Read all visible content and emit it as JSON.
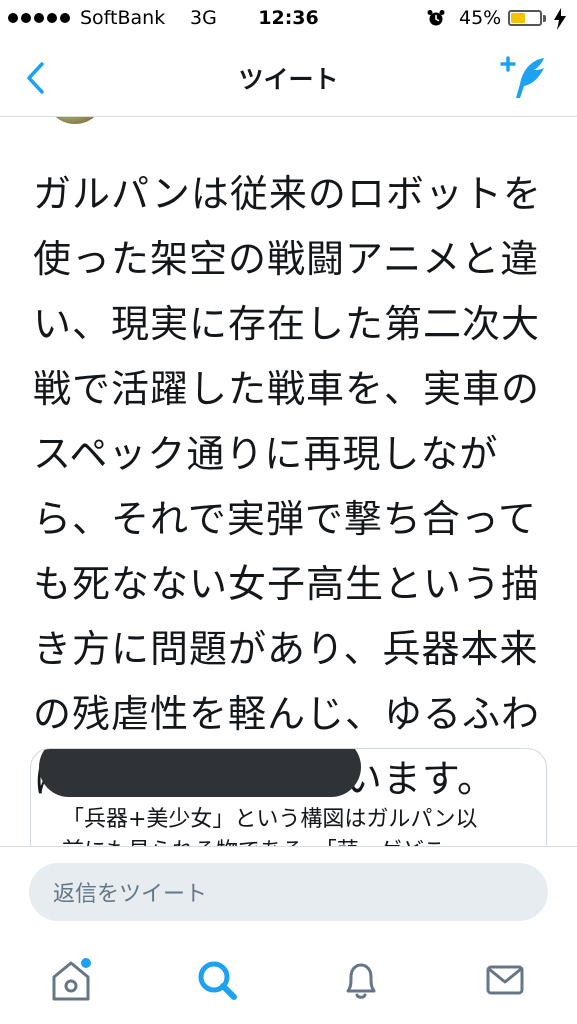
{
  "status_bar": {
    "carrier": "SoftBank",
    "network": "3G",
    "time": "12:36",
    "battery_percent": "45%",
    "battery_level": 0.45,
    "signal_bars": 5
  },
  "header": {
    "title": "ツイート",
    "back_icon": "chevron-left-icon",
    "compose_icon": "compose-tweet-icon",
    "accent_color": "#1da1f2"
  },
  "tweet": {
    "text": "ガルパンは従来のロボットを使った架空の戦闘アニメと違い、現実に存在した第二次大戦で活躍した戦車を、実車のスペック通りに再現しながら、それで実弾で撃ち合っても死なない女子高生という描き方に問題があり、兵器本来の残虐性を軽んじ、ゆるふわに描きぼやかしています。"
  },
  "quote": {
    "line1": "「兵器+美少女」という構図はガルパン以",
    "line2": "前にも見られる物である。「萌...ゲどこ"
  },
  "reply": {
    "placeholder": "返信をツイート"
  },
  "tabs": [
    {
      "name": "home",
      "icon": "home-icon",
      "badge": true
    },
    {
      "name": "search",
      "icon": "search-icon",
      "active": true
    },
    {
      "name": "notifications",
      "icon": "bell-icon"
    },
    {
      "name": "messages",
      "icon": "mail-icon"
    }
  ]
}
